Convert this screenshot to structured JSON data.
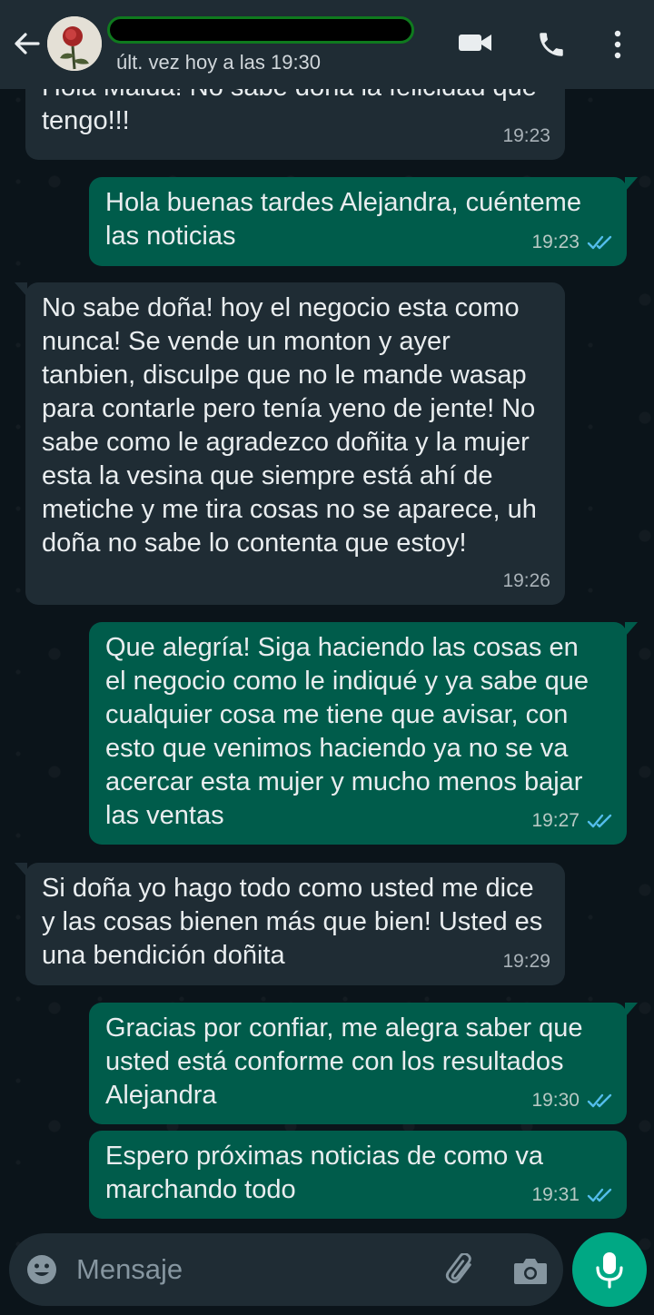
{
  "header": {
    "last_seen": "últ. vez hoy a las 19:30"
  },
  "messages": [
    {
      "direction": "in",
      "text": "Hola Maida! No sabe doña la felicidad que tengo!!!",
      "time": "19:23"
    },
    {
      "direction": "out",
      "text": "Hola buenas tardes Alejandra, cuénteme las noticias",
      "time": "19:23",
      "status": "read"
    },
    {
      "direction": "in",
      "text": "No sabe doña! hoy el negocio esta como nunca! Se vende un monton y ayer tanbien, disculpe que no le mande wasap para contarle pero tenía yeno de jente! No sabe como le agradezco doñita y la mujer esta la vesina que siempre está ahí de metiche y me tira cosas no se aparece, uh doña no sabe lo contenta que estoy!",
      "time": "19:26"
    },
    {
      "direction": "out",
      "text": "Que alegría! Siga haciendo las cosas en el negocio como le indiqué y ya sabe que cualquier cosa me tiene que avisar, con esto que venimos haciendo ya no se va acercar esta mujer y mucho menos bajar las ventas",
      "time": "19:27",
      "status": "read"
    },
    {
      "direction": "in",
      "text": "Si doña yo hago todo como usted me dice y las cosas bienen más que bien! Usted es una bendición doñita",
      "time": "19:29"
    },
    {
      "direction": "out",
      "text": "Gracias por confiar, me alegra saber que usted está conforme con los resultados Alejandra",
      "time": "19:30",
      "status": "read"
    },
    {
      "direction": "out",
      "text": "Espero próximas noticias de como va marchando todo",
      "time": "19:31",
      "status": "read"
    }
  ],
  "composer": {
    "placeholder": "Mensaje"
  },
  "colors": {
    "incoming_bubble": "#1f2c34",
    "outgoing_bubble": "#005c4b",
    "read_ticks": "#53bdeb",
    "accent": "#00a884"
  },
  "icons": [
    "back-arrow-icon",
    "video-call-icon",
    "phone-icon",
    "more-options-icon",
    "emoji-icon",
    "attach-icon",
    "camera-icon",
    "mic-icon",
    "double-check-icon"
  ]
}
